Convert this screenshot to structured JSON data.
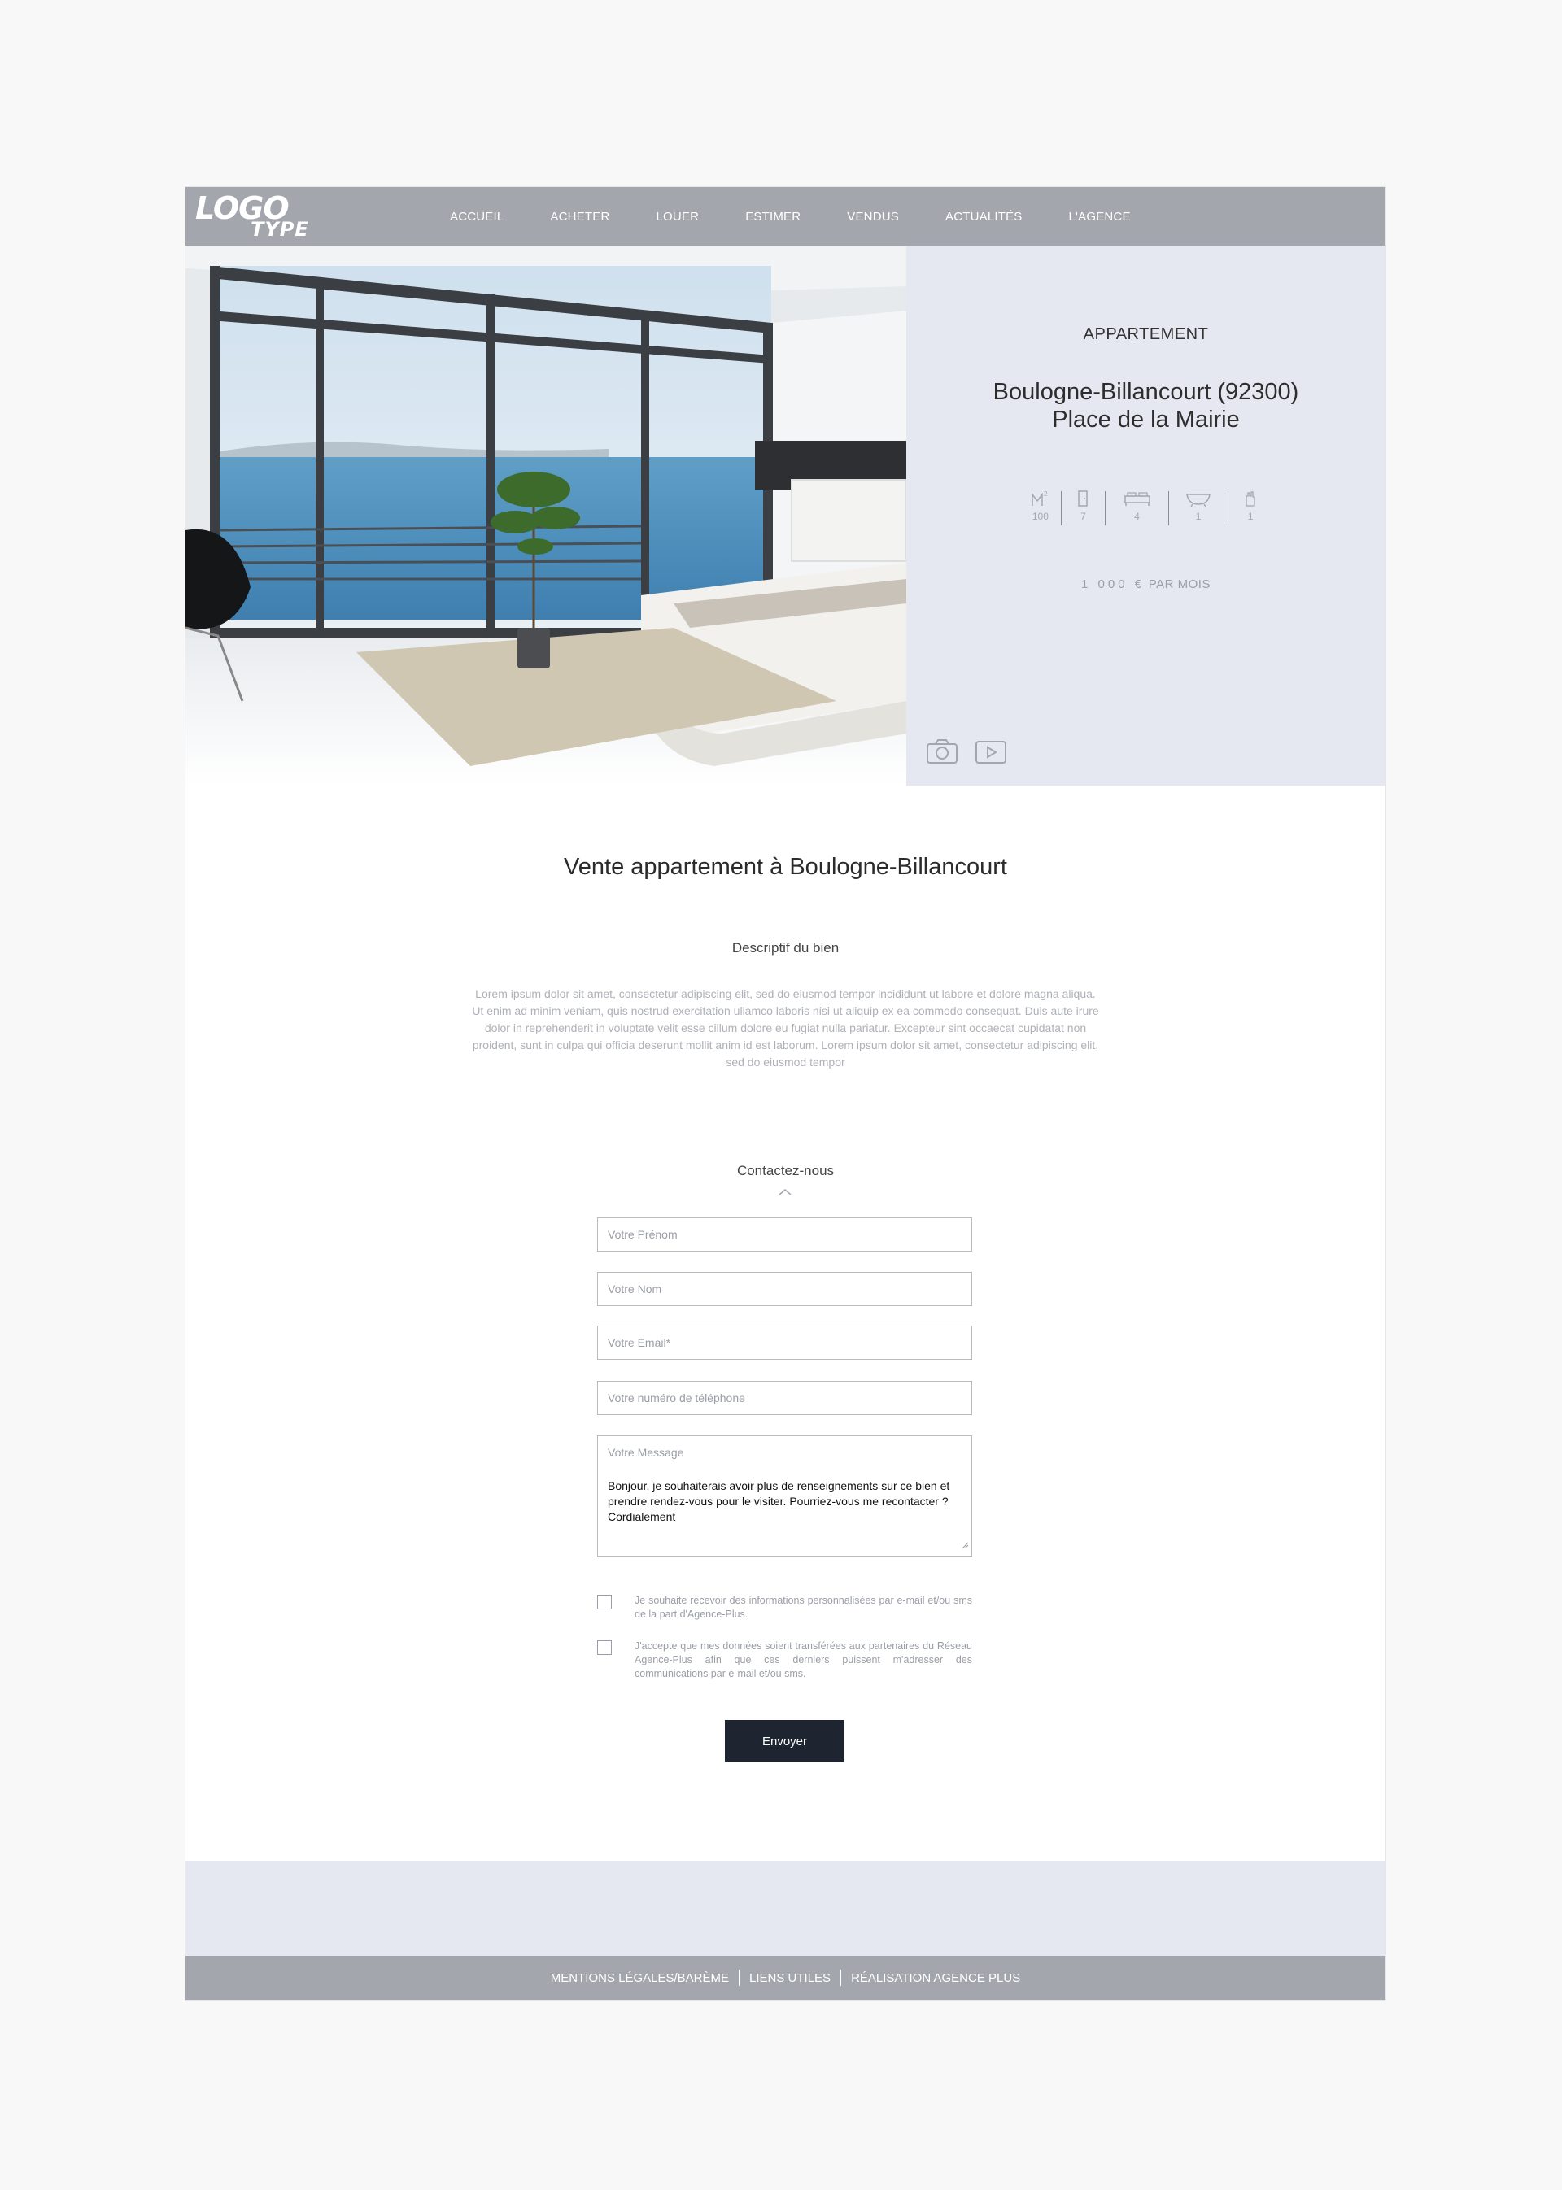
{
  "header": {
    "logo_line1": "LOGO",
    "logo_line2": "TYPE",
    "nav": [
      "ACCUEIL",
      "ACHETER",
      "LOUER",
      "ESTIMER",
      "VENDUS",
      "ACTUALITÉS",
      "L'AGENCE"
    ]
  },
  "property": {
    "type": "APPARTEMENT",
    "city": "Boulogne-Billancourt (92300)",
    "address": "Place de la Mairie",
    "features": [
      {
        "icon": "surface-m2-icon",
        "value": "100"
      },
      {
        "icon": "door-icon",
        "value": "7"
      },
      {
        "icon": "bed-icon",
        "value": "4"
      },
      {
        "icon": "bathtub-icon",
        "value": "1"
      },
      {
        "icon": "hand-icon",
        "value": "1"
      }
    ],
    "price_amount": "1 000 €",
    "price_period": "PAR MOIS"
  },
  "content": {
    "title": "Vente appartement à Boulogne-Billancourt",
    "desc_title": "Descriptif du bien",
    "desc_text": "Lorem ipsum dolor sit amet, consectetur adipiscing elit, sed do eiusmod tempor incididunt ut labore et dolore magna aliqua. Ut enim ad minim veniam, quis nostrud exercitation ullamco laboris nisi ut aliquip ex ea commodo consequat. Duis aute irure dolor in reprehenderit in voluptate velit esse cillum dolore eu fugiat nulla pariatur. Excepteur sint occaecat cupidatat non proident, sunt in culpa qui officia deserunt mollit anim id est laborum. Lorem ipsum dolor sit amet, consectetur adipiscing elit, sed do eiusmod tempor"
  },
  "form": {
    "title": "Contactez-nous",
    "firstname_placeholder": "Votre Prénom",
    "lastname_placeholder": "Votre Nom",
    "email_placeholder": "Votre Email*",
    "phone_placeholder": "Votre numéro de téléphone",
    "message_placeholder": "Votre Message",
    "message_value": "Bonjour, je souhaiterais avoir plus de renseignements sur ce bien et prendre rendez-vous pour le visiter. Pourriez-vous me recontacter ? Cordialement",
    "consent_1": "Je souhaite recevoir des informations personnalisées par e-mail et/ou sms de la part d'Agence-Plus.",
    "consent_2": "J'accepte que mes données soient transférées aux partenaires du Réseau Agence-Plus afin que ces derniers puissent m'adresser des communications par e-mail et/ou sms.",
    "submit_label": "Envoyer"
  },
  "footer": {
    "links": [
      "MENTIONS LÉGALES/BARÈME",
      "LIENS UTILES",
      "RÉALISATION AGENCE PLUS"
    ]
  }
}
